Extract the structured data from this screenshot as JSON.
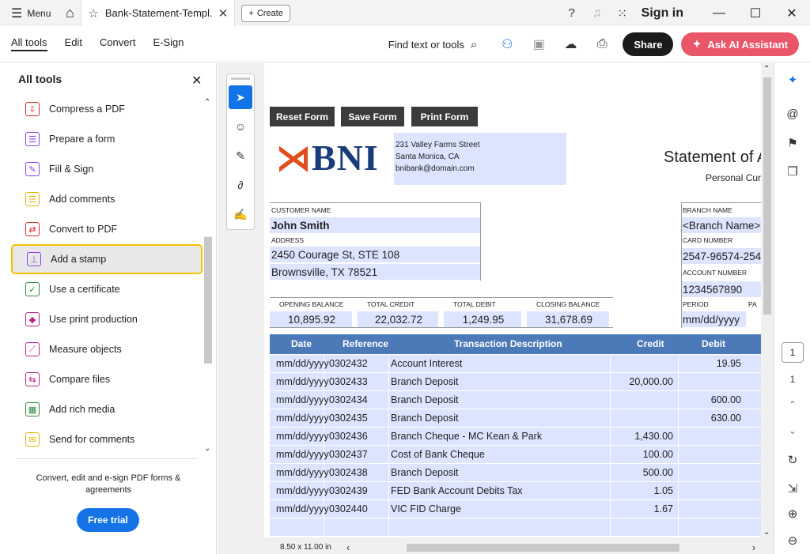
{
  "titlebar": {
    "menu_label": "Menu",
    "tab_title": "Bank-Statement-Templ...",
    "create_label": "Create",
    "signin_label": "Sign in"
  },
  "toolbar": {
    "tabs": [
      "All tools",
      "Edit",
      "Convert",
      "E-Sign"
    ],
    "find_label": "Find text or tools",
    "share_label": "Share",
    "ai_label": "Ask AI Assistant"
  },
  "sidebar": {
    "title": "All tools",
    "items": [
      {
        "label": "Compress a PDF",
        "icon": "compress-pdf-icon",
        "color": "#e0282e",
        "glyph": "⇩"
      },
      {
        "label": "Prepare a form",
        "icon": "form-icon",
        "color": "#8a3ff0",
        "glyph": "☰"
      },
      {
        "label": "Fill & Sign",
        "icon": "fill-sign-icon",
        "color": "#8a3ff0",
        "glyph": "✎"
      },
      {
        "label": "Add comments",
        "icon": "comment-icon",
        "color": "#e6b400",
        "glyph": "☰"
      },
      {
        "label": "Convert to PDF",
        "icon": "convert-pdf-icon",
        "color": "#e0282e",
        "glyph": "⇄"
      },
      {
        "label": "Add a stamp",
        "icon": "stamp-icon",
        "color": "#8a3ff0",
        "glyph": "⊥"
      },
      {
        "label": "Use a certificate",
        "icon": "certificate-icon",
        "color": "#2b8a3e",
        "glyph": "✓"
      },
      {
        "label": "Use print production",
        "icon": "print-production-icon",
        "color": "#c0208a",
        "glyph": "◆"
      },
      {
        "label": "Measure objects",
        "icon": "measure-icon",
        "color": "#c0208a",
        "glyph": "⟋"
      },
      {
        "label": "Compare files",
        "icon": "compare-icon",
        "color": "#c0208a",
        "glyph": "⇆"
      },
      {
        "label": "Add rich media",
        "icon": "rich-media-icon",
        "color": "#2b8a3e",
        "glyph": "▦"
      },
      {
        "label": "Send for comments",
        "icon": "send-comments-icon",
        "color": "#e6b400",
        "glyph": "✉"
      }
    ],
    "promo": "Convert, edit and e-sign PDF forms & agreements",
    "trial_label": "Free trial"
  },
  "document": {
    "buttons": [
      "Reset Form",
      "Save Form",
      "Print Form"
    ],
    "bank_name": "BNI",
    "address": [
      "231 Valley Farms Street",
      "Santa Monica, CA",
      "bnibank@domain.com"
    ],
    "statement_title": "Statement of A",
    "statement_sub": "Personal Cur",
    "customer_name_label": "CUSTOMER NAME",
    "customer_name": "John Smith",
    "address_label": "ADDRESS",
    "address_line1": "2450 Courage St, STE 108",
    "address_line2": "Brownsville, TX 78521",
    "branch_name_label": "BRANCH NAME",
    "branch_name": "<Branch Name>",
    "card_number_label": "CARD NUMBER",
    "card_number": "2547-96574-254",
    "account_number_label": "ACCOUNT NUMBER",
    "account_number": "1234567890",
    "period_label": "PERIOD",
    "period": "mm/dd/yyyy",
    "page_label": "PA",
    "balances": [
      {
        "label": "OPENING BALANCE",
        "value": "10,895.92"
      },
      {
        "label": "TOTAL CREDIT",
        "value": "22,032.72"
      },
      {
        "label": "TOTAL DEBIT",
        "value": "1,249.95"
      },
      {
        "label": "CLOSING BALANCE",
        "value": "31,678.69"
      }
    ],
    "columns": [
      "Date",
      "Reference",
      "Transaction Description",
      "Credit",
      "Debit"
    ],
    "rows": [
      {
        "date": "mm/dd/yyyy",
        "ref": "0302432",
        "desc": "Account Interest",
        "credit": "",
        "debit": "19.95"
      },
      {
        "date": "mm/dd/yyyy",
        "ref": "0302433",
        "desc": "Branch Deposit",
        "credit": "20,000.00",
        "debit": ""
      },
      {
        "date": "mm/dd/yyyy",
        "ref": "0302434",
        "desc": "Branch Deposit",
        "credit": "",
        "debit": "600.00"
      },
      {
        "date": "mm/dd/yyyy",
        "ref": "0302435",
        "desc": "Branch Deposit",
        "credit": "",
        "debit": "630.00"
      },
      {
        "date": "mm/dd/yyyy",
        "ref": "0302436",
        "desc": "Branch Cheque - MC Kean & Park",
        "credit": "1,430.00",
        "debit": ""
      },
      {
        "date": "mm/dd/yyyy",
        "ref": "0302437",
        "desc": "Cost of Bank Cheque",
        "credit": "100.00",
        "debit": ""
      },
      {
        "date": "mm/dd/yyyy",
        "ref": "0302438",
        "desc": "Branch Deposit",
        "credit": "500.00",
        "debit": ""
      },
      {
        "date": "mm/dd/yyyy",
        "ref": "0302439",
        "desc": "FED Bank Account Debits Tax",
        "credit": "1.05",
        "debit": ""
      },
      {
        "date": "mm/dd/yyyy",
        "ref": "0302440",
        "desc": "VIC FID Charge",
        "credit": "1.67",
        "debit": ""
      },
      {
        "date": "",
        "ref": "",
        "desc": "",
        "credit": "",
        "debit": ""
      }
    ],
    "page_size": "8.50 x 11.00 in"
  },
  "rail": {
    "page_current": "1",
    "page_total": "1"
  }
}
